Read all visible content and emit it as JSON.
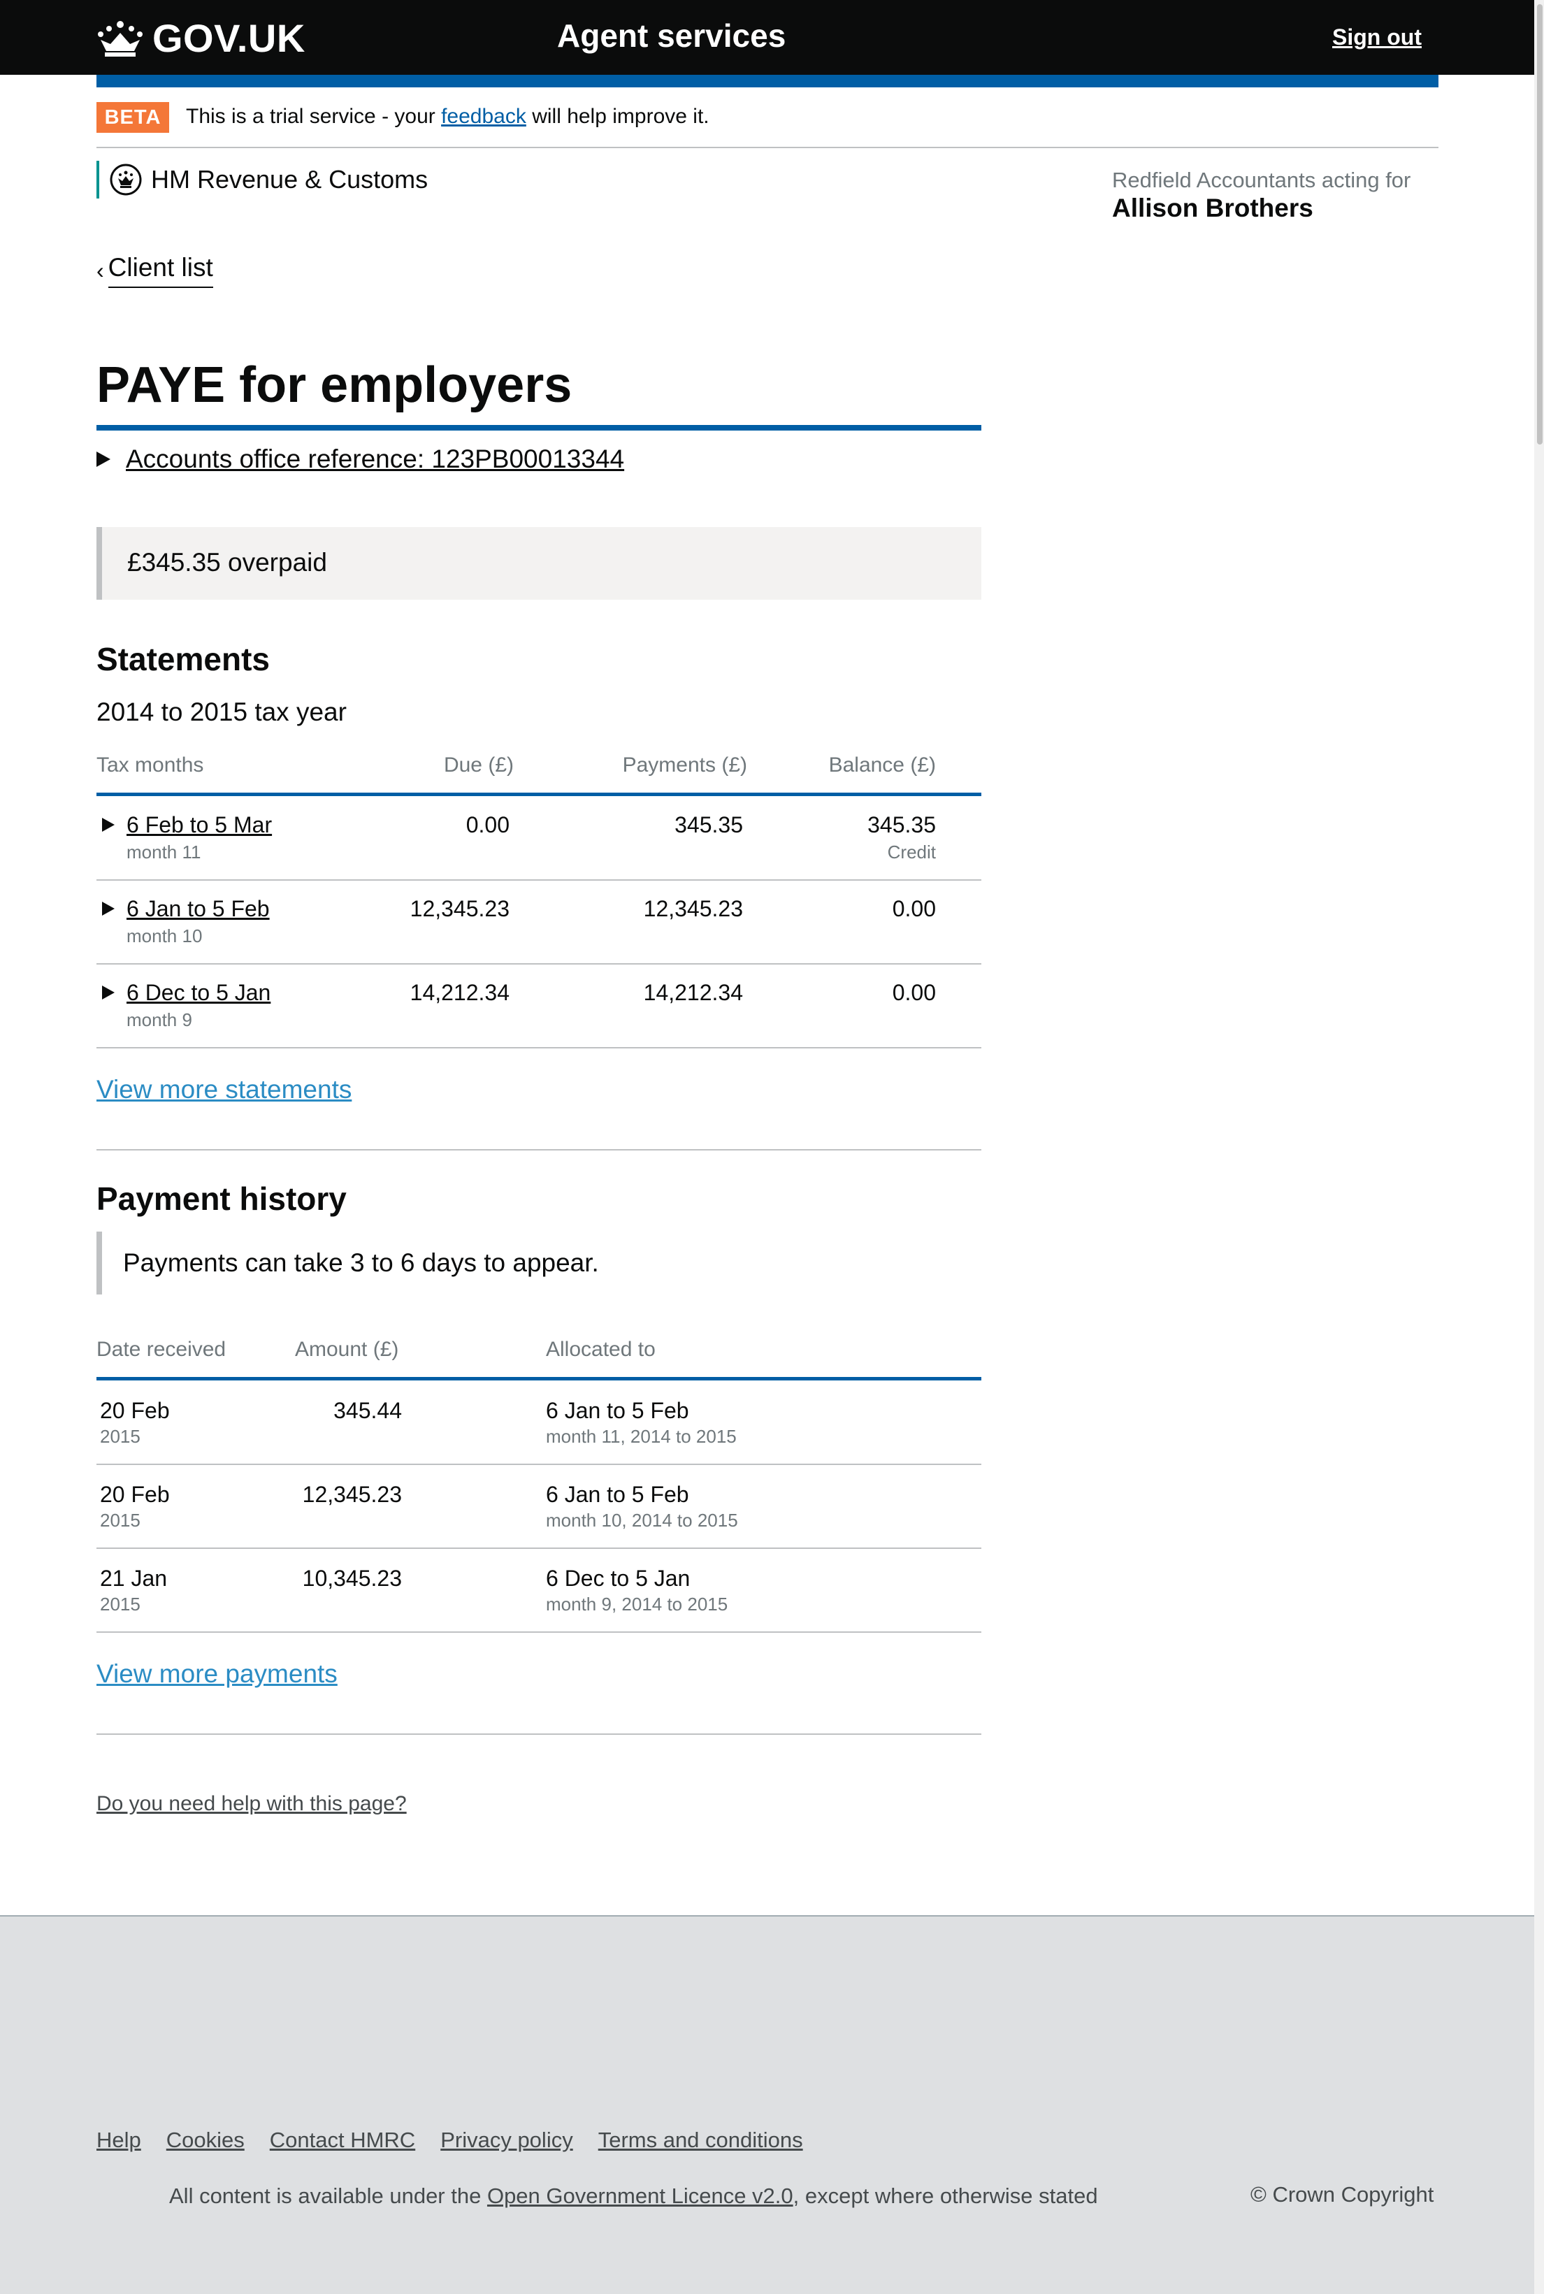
{
  "header": {
    "logo_text": "GOV.UK",
    "service_name": "Agent services",
    "sign_out": "Sign out"
  },
  "phase_banner": {
    "tag": "BETA",
    "text_before": "This is a trial service - your ",
    "link": "feedback",
    "text_after": " will help improve it."
  },
  "department": "HM Revenue & Customs",
  "acting": {
    "label": "Redfield Accountants acting for",
    "client": "Allison Brothers"
  },
  "back_link": "Client list",
  "page_title": "PAYE for employers",
  "details_summary": "Accounts office reference: 123PB00013344",
  "panel_text": "£345.35 overpaid",
  "statements": {
    "heading": "Statements",
    "tax_year": "2014 to 2015 tax year",
    "columns": [
      "Tax months",
      "Due (£)",
      "Payments (£)",
      "Balance (£)"
    ],
    "rows": [
      {
        "period": "6 Feb to 5 Mar",
        "month": "month 11",
        "due": "0.00",
        "payments": "345.35",
        "balance": "345.35",
        "balance_note": "Credit"
      },
      {
        "period": "6 Jan to 5 Feb",
        "month": "month 10",
        "due": "12,345.23",
        "payments": "12,345.23",
        "balance": "0.00",
        "balance_note": ""
      },
      {
        "period": "6 Dec to 5 Jan",
        "month": "month 9",
        "due": "14,212.34",
        "payments": "14,212.34",
        "balance": "0.00",
        "balance_note": ""
      }
    ],
    "view_more": "View more statements"
  },
  "payment_history": {
    "heading": "Payment history",
    "inset": "Payments can take 3 to 6 days to appear.",
    "columns": [
      "Date received",
      "Amount (£)",
      "Allocated to"
    ],
    "rows": [
      {
        "date": "20 Feb",
        "year": "2015",
        "amount": "345.44",
        "allocated": "6 Jan to 5 Feb",
        "allocated_note": "month 11, 2014 to 2015"
      },
      {
        "date": "20 Feb",
        "year": "2015",
        "amount": "12,345.23",
        "allocated": "6 Jan to 5 Feb",
        "allocated_note": "month 10, 2014 to 2015"
      },
      {
        "date": "21 Jan",
        "year": "2015",
        "amount": "10,345.23",
        "allocated": "6 Dec to 5 Jan",
        "allocated_note": "month 9, 2014 to 2015"
      }
    ],
    "view_more": "View more payments"
  },
  "help_link": "Do you need help with this page?",
  "footer": {
    "links": [
      "Help",
      "Cookies",
      "Contact HMRC",
      "Privacy policy",
      "Terms and conditions"
    ],
    "licence_before": "All content is available under the ",
    "licence_link": "Open Government Licence v2.0",
    "licence_after": ", except where otherwise stated",
    "copyright": "© Crown Copyright"
  },
  "colors": {
    "header_bg": "#0b0c0c",
    "brand_blue": "#005ea5",
    "link_blue": "#2b8cc4",
    "beta_orange": "#f47738",
    "hmrc_teal": "#009390",
    "footer_bg": "#dee0e2"
  }
}
